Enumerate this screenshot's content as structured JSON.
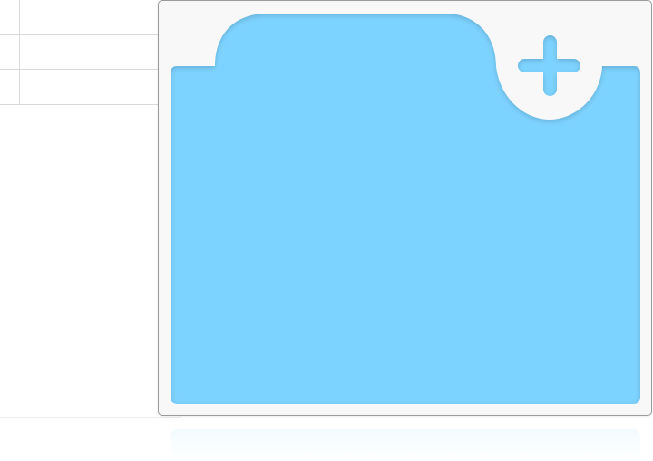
{
  "grid": {
    "rows": [
      {
        "cells": [
          "",
          ""
        ]
      },
      {
        "cells": [
          "",
          ""
        ]
      },
      {
        "cells": [
          "",
          ""
        ]
      }
    ]
  },
  "drop_zone": {
    "icon": "plus-icon",
    "fill_color": "#7dd3ff",
    "frame_color": "#f8f8f8",
    "border_color": "#9a9a9a"
  }
}
